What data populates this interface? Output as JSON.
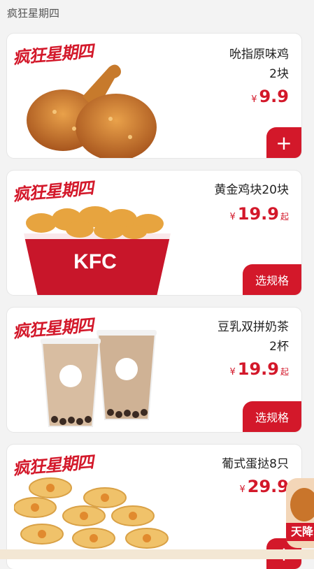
{
  "page": {
    "title": "疯狂星期四"
  },
  "products": [
    {
      "promo": "疯狂星期四",
      "name_line1": "吮指原味鸡",
      "name_line2": "2块",
      "currency": "¥",
      "price": "9.9",
      "suffix": "",
      "action": "+",
      "action_type": "add"
    },
    {
      "promo": "疯狂星期四",
      "name_line1": "黄金鸡块20块",
      "name_line2": "",
      "currency": "¥",
      "price": "19.9",
      "suffix": "起",
      "action": "选规格",
      "action_type": "spec",
      "bucket_text": "KFC"
    },
    {
      "promo": "疯狂星期四",
      "name_line1": "豆乳双拼奶茶",
      "name_line2": "2杯",
      "currency": "¥",
      "price": "19.9",
      "suffix": "起",
      "action": "选规格",
      "action_type": "spec"
    },
    {
      "promo": "疯狂星期四",
      "name_line1": "葡式蛋挞8只",
      "name_line2": "",
      "currency": "¥",
      "price": "29.9",
      "suffix": "",
      "action": "+",
      "action_type": "add"
    }
  ],
  "floating_ad": {
    "text": "天降"
  },
  "colors": {
    "accent": "#d3182a"
  }
}
